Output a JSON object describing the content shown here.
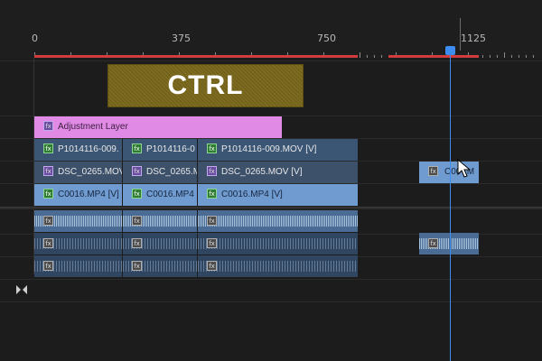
{
  "ruler": {
    "labels": [
      "0",
      "375",
      "750",
      "1125"
    ]
  },
  "overlay": {
    "ctrl_text": "CTRL"
  },
  "tracks": {
    "adjustment": {
      "label": "Adjustment Layer",
      "fx": "fx"
    },
    "v3": {
      "clips": [
        {
          "label": "P1014116-009.",
          "fx": "fx"
        },
        {
          "label": "P1014116-0",
          "fx": "fx"
        },
        {
          "label": "P1014116-009.MOV [V]",
          "fx": "fx"
        }
      ]
    },
    "v2": {
      "clips": [
        {
          "label": "DSC_0265.MOV",
          "fx": "fx"
        },
        {
          "label": "DSC_0265.M",
          "fx": "fx"
        },
        {
          "label": "DSC_0265.MOV [V]",
          "fx": "fx"
        }
      ],
      "moved_clip": {
        "label": "C00",
        "fx": "fx",
        "suffix": ".M"
      }
    },
    "v1": {
      "clips": [
        {
          "label": "C0016.MP4 [V]",
          "fx": "fx"
        },
        {
          "label": "C0016.MP4 [",
          "fx": "fx"
        },
        {
          "label": "C0016.MP4 [V]",
          "fx": "fx"
        }
      ]
    },
    "audio": {
      "fx": "fx"
    }
  },
  "colors": {
    "playhead": "#3d8cf0",
    "in_out_bar": "#d23c3c",
    "adjustment_clip": "#e08ae6",
    "v1_clip": "#6f9bd1",
    "ctrl_overlay": "#7d6b1f"
  },
  "icons": [
    "fx-badge-icon",
    "playhead-icon",
    "mouse-cursor-icon",
    "gap-marker-icon"
  ]
}
